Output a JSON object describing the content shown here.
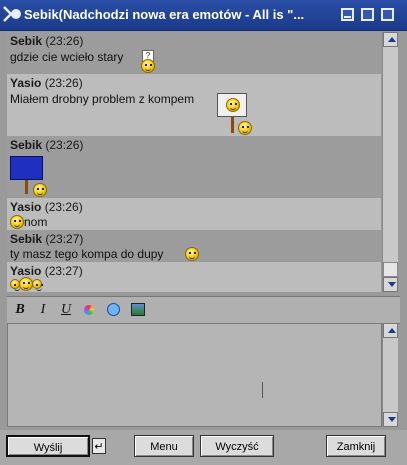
{
  "window": {
    "title": "Sebik(Nadchodzi nowa era emotów - All is \"..."
  },
  "messages": [
    {
      "nick": "Sebik",
      "time": "(23:26)",
      "text": "gdzie cie wcieło stary"
    },
    {
      "nick": "Yasio",
      "time": "(23:26)",
      "text": "Miałem drobny problem z kompem"
    },
    {
      "nick": "Sebik",
      "time": "(23:26)",
      "text": ""
    },
    {
      "nick": "Yasio",
      "time": "(23:26)",
      "text": "nom"
    },
    {
      "nick": "Sebik",
      "time": "(23:27)",
      "text": "ty masz tego kompa do dupy"
    },
    {
      "nick": "Yasio",
      "time": "(23:27)",
      "text": ""
    }
  ],
  "toolbar": {
    "bold": "B",
    "italic": "I",
    "underline": "U"
  },
  "input": {
    "value": ""
  },
  "buttons": {
    "send": "Wyślij",
    "enter": "↵",
    "menu": "Menu",
    "clear": "Wyczyść",
    "close": "Zamknij"
  },
  "icons": [
    "window-app-icon",
    "minimize-icon",
    "maximize-icon",
    "close-icon",
    "smiley-icon",
    "emoticon-icon",
    "image-icon",
    "color-palette-icon"
  ]
}
